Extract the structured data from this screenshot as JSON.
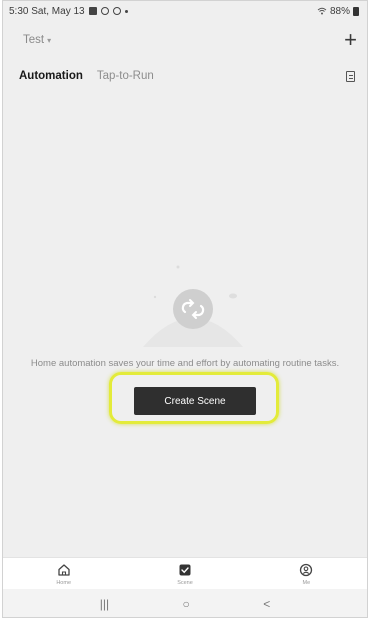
{
  "status_bar": {
    "time_date": "5:30  Sat, May 13",
    "battery": "88%"
  },
  "header": {
    "home_name": "Test",
    "home_caret": "▾",
    "add_icon": "+"
  },
  "tabs": [
    {
      "label": "Automation",
      "active": true
    },
    {
      "label": "Tap-to-Run",
      "active": false
    }
  ],
  "empty_state": {
    "message": "Home automation saves your time and effort by automating routine tasks.",
    "button_label": "Create Scene"
  },
  "bottom_nav": [
    {
      "label": "Home",
      "icon": "home-icon"
    },
    {
      "label": "Scene",
      "icon": "scene-icon",
      "active": true
    },
    {
      "label": "Me",
      "icon": "profile-icon"
    }
  ],
  "system_nav": {
    "recents": "|||",
    "home": "○",
    "back": "<"
  },
  "colors": {
    "background": "#efefef",
    "button": "#2f2f2f",
    "highlight": "#e3eb3a"
  }
}
